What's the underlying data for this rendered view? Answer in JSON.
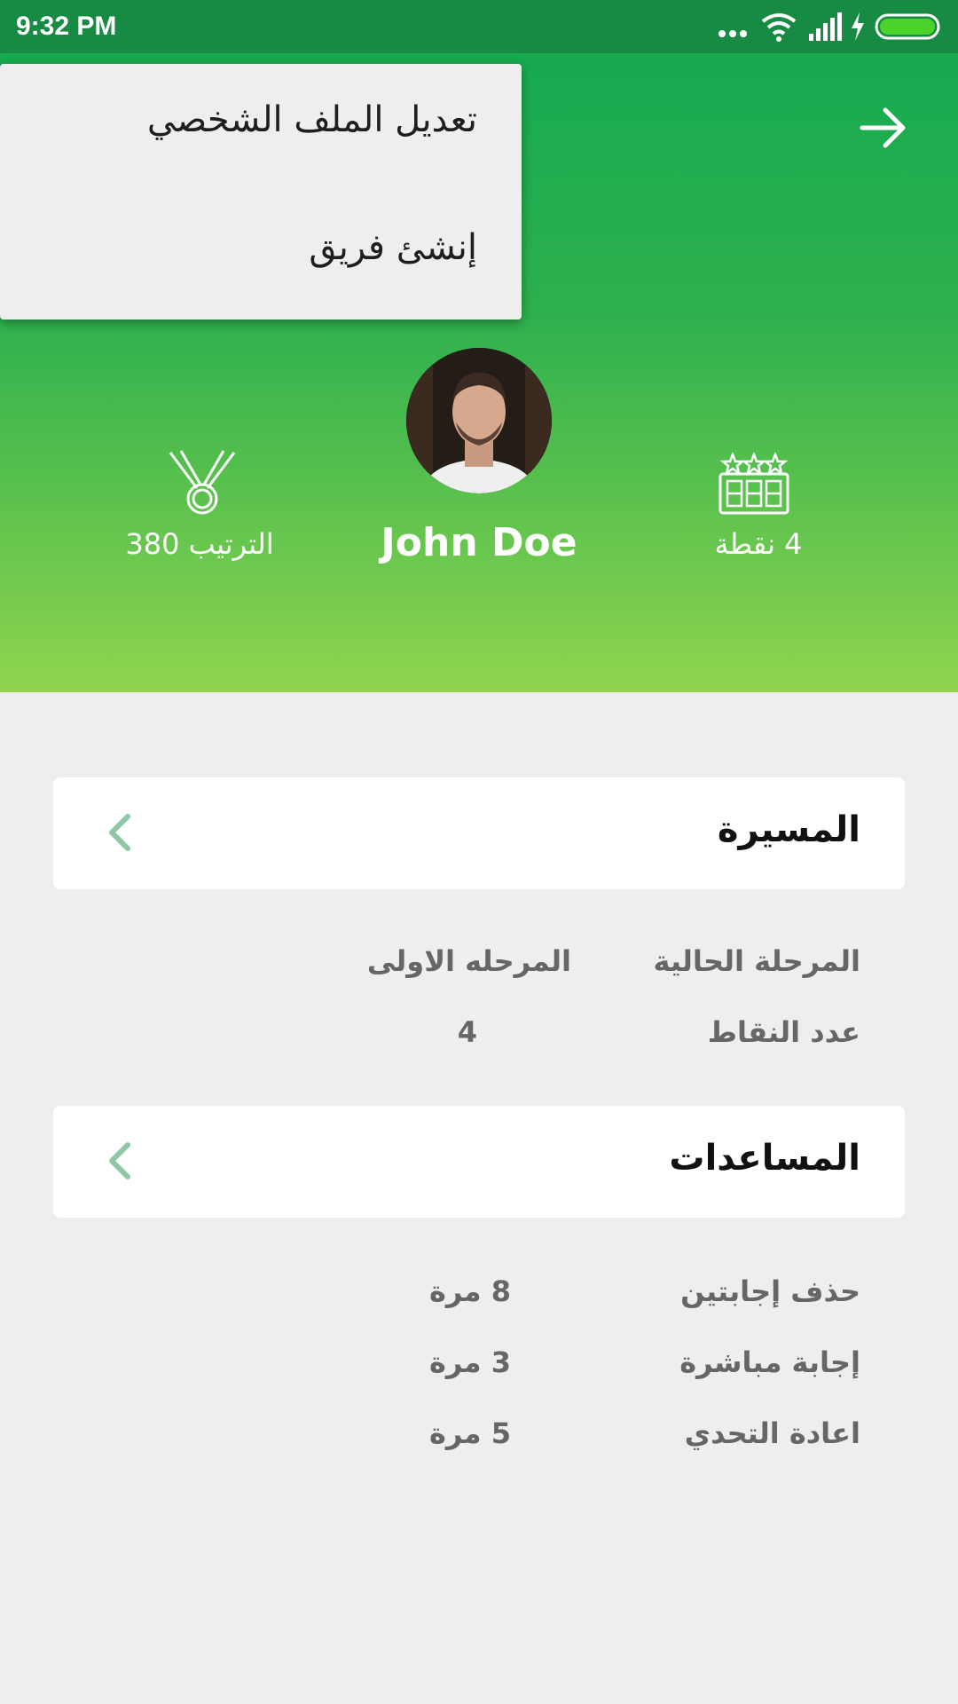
{
  "status_bar": {
    "time": "9:32 PM",
    "icons": [
      "more-dots-icon",
      "wifi-icon",
      "signal-icon",
      "charging-icon",
      "battery-icon"
    ]
  },
  "header": {
    "back_icon": "arrow-right-icon",
    "user_name": "John Doe",
    "rank_label": "الترتيب 380",
    "points_label": "4 نقطة",
    "rank_icon": "medal-icon",
    "points_icon": "scoreboard-icon"
  },
  "menu": {
    "items": [
      "تعديل الملف الشخصي",
      "إنشئ فريق"
    ]
  },
  "journey": {
    "title": "المسيرة",
    "rows": [
      {
        "label": "المرحلة الحالية",
        "value": "المرحله الاولى"
      },
      {
        "label": "عدد النقاط",
        "value": "4"
      }
    ]
  },
  "helps": {
    "title": "المساعدات",
    "rows": [
      {
        "label": "حذف إجابتين",
        "value": "8 مرة"
      },
      {
        "label": "إجابة مباشرة",
        "value": "3 مرة"
      },
      {
        "label": "اعادة التحدي",
        "value": "5 مرة"
      }
    ]
  },
  "colors": {
    "status_bar": "#178a43",
    "header_top": "#17aa50",
    "header_bottom": "#90d44f",
    "chevron": "#8fc7a6",
    "background": "#eeeeee"
  }
}
